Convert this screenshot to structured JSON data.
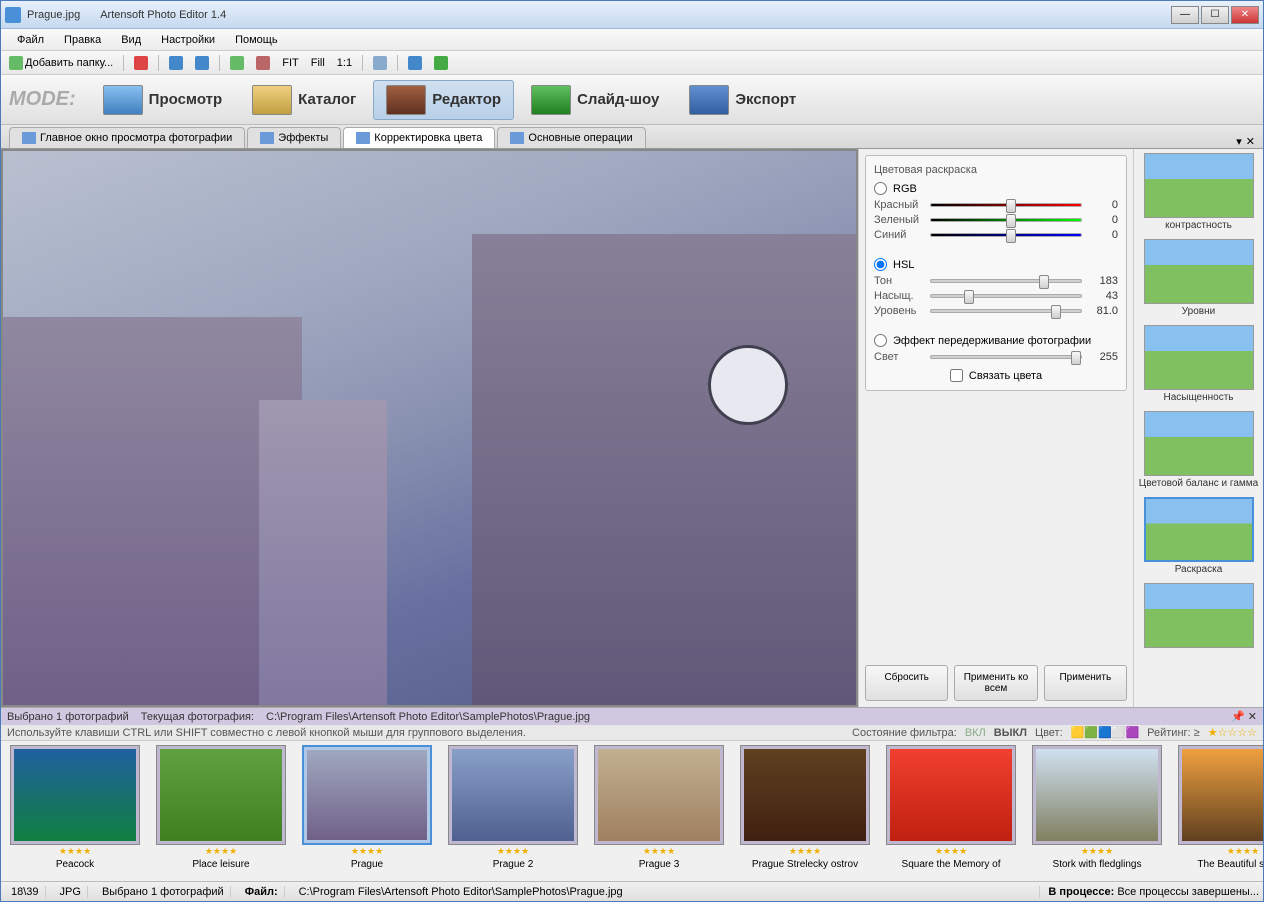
{
  "title": {
    "file": "Prague.jpg",
    "app": "Artensoft Photo Editor 1.4"
  },
  "menu": [
    "Файл",
    "Правка",
    "Вид",
    "Настройки",
    "Помощь"
  ],
  "toolbar": {
    "addFolder": "Добавить папку...",
    "fit": "FIT",
    "fill": "Fill",
    "oneToOne": "1:1"
  },
  "mode": {
    "label": "MODE:",
    "items": [
      {
        "label": "Просмотр"
      },
      {
        "label": "Каталог"
      },
      {
        "label": "Редактор",
        "active": true
      },
      {
        "label": "Слайд-шоу"
      },
      {
        "label": "Экспорт"
      }
    ]
  },
  "tabs": [
    {
      "label": "Главное окно просмотра фотографии"
    },
    {
      "label": "Эффекты"
    },
    {
      "label": "Корректировка цвета",
      "active": true
    },
    {
      "label": "Основные операции"
    }
  ],
  "colorPanel": {
    "title": "Цветовая раскраска",
    "rgb": {
      "label": "RGB",
      "checked": false,
      "sliders": [
        {
          "label": "Красный",
          "value": 0,
          "pos": 50,
          "cls": "red"
        },
        {
          "label": "Зеленый",
          "value": 0,
          "pos": 50,
          "cls": "green"
        },
        {
          "label": "Синий",
          "value": 0,
          "pos": 50,
          "cls": "blue"
        }
      ]
    },
    "hsl": {
      "label": "HSL",
      "checked": true,
      "sliders": [
        {
          "label": "Тон",
          "value": 183,
          "pos": 72
        },
        {
          "label": "Насыщ.",
          "value": 43,
          "pos": 22
        },
        {
          "label": "Уровень",
          "value": "81.0",
          "pos": 80
        }
      ]
    },
    "effect": {
      "label": "Эффект передерживание фотографии",
      "checked": false
    },
    "light": {
      "label": "Свет",
      "value": 255,
      "pos": 100
    },
    "link": {
      "label": "Связать цвета",
      "checked": false
    },
    "buttons": {
      "reset": "Сбросить",
      "applyAll": "Применить ко всем",
      "apply": "Применить"
    }
  },
  "presets": [
    {
      "label": "контрастность"
    },
    {
      "label": "Уровни"
    },
    {
      "label": "Насыщенность"
    },
    {
      "label": "Цветовой баланс и гамма"
    },
    {
      "label": "Раскраска",
      "selected": true
    },
    {
      "label": ""
    }
  ],
  "infobar": {
    "selected": "Выбрано 1  фотографий",
    "current": "Текущая фотография:",
    "path": "C:\\Program Files\\Artensoft Photo Editor\\SamplePhotos\\Prague.jpg"
  },
  "hint": "Используйте клавиши CTRL или SHIFT совместно с левой кнопкой мыши для группового выделения.",
  "filter": {
    "state": "Состояние фильтра:",
    "on": "ВКЛ",
    "off": "ВЫКЛ",
    "color": "Цвет:",
    "rating": "Рейтинг: ≥"
  },
  "thumbs": [
    {
      "name": "Peacock",
      "bg": "linear-gradient(#2060a0,#108040)"
    },
    {
      "name": "Place leisure",
      "bg": "linear-gradient(#60a040,#408020)"
    },
    {
      "name": "Prague",
      "bg": "linear-gradient(#a0a8c0,#706088)",
      "selected": true
    },
    {
      "name": "Prague 2",
      "bg": "linear-gradient(#88a0c8,#506090)"
    },
    {
      "name": "Prague 3",
      "bg": "linear-gradient(#c0b090,#a08060)"
    },
    {
      "name": "Prague Strelecky ostrov",
      "bg": "linear-gradient(#604020,#402010)"
    },
    {
      "name": "Square the Memory of",
      "bg": "linear-gradient(#f04030,#c02010)"
    },
    {
      "name": "Stork with fledglings",
      "bg": "linear-gradient(#d0e0f0,#808060)"
    },
    {
      "name": "The Beautiful sunset",
      "bg": "linear-gradient(#f0a040,#604020)"
    }
  ],
  "status": {
    "count": "18\\39",
    "fmt": "JPG",
    "sel": "Выбрано 1 фотографий",
    "fileLabel": "Файл:",
    "file": "C:\\Program Files\\Artensoft Photo Editor\\SamplePhotos\\Prague.jpg",
    "procLabel": "В процессе:",
    "proc": "Все процессы завершены..."
  }
}
